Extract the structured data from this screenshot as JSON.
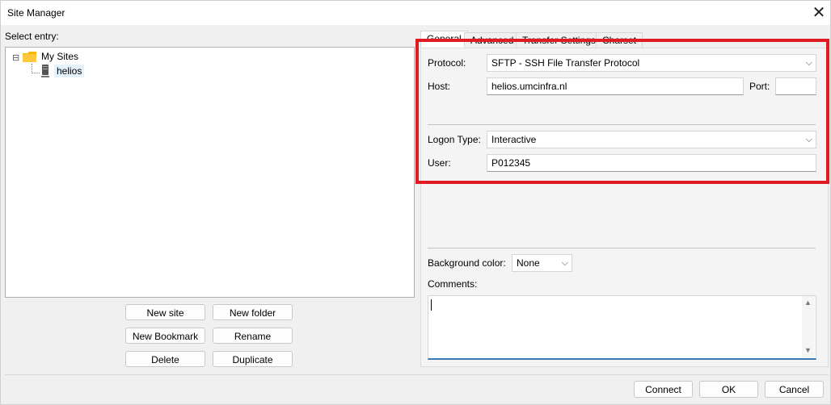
{
  "window": {
    "title": "Site Manager",
    "close_glyph": "✕"
  },
  "left": {
    "select_entry_label": "Select entry:",
    "tree": {
      "root": {
        "label": "My Sites",
        "expander": "⊟"
      },
      "child": {
        "label": "helios"
      }
    },
    "buttons": {
      "new_site": "New site",
      "new_folder": "New folder",
      "new_bookmark": "New Bookmark",
      "rename": "Rename",
      "delete": "Delete",
      "duplicate": "Duplicate"
    }
  },
  "tabs": [
    {
      "label": "General"
    },
    {
      "label": "Advanced"
    },
    {
      "label": "Transfer Settings"
    },
    {
      "label": "Charset"
    }
  ],
  "general": {
    "protocol_label": "Protocol:",
    "protocol_value": "SFTP - SSH File Transfer Protocol",
    "host_label": "Host:",
    "host_value": "helios.umcinfra.nl",
    "port_label": "Port:",
    "port_value": "",
    "logon_type_label": "Logon Type:",
    "logon_type_value": "Interactive",
    "user_label": "User:",
    "user_value": "P012345",
    "background_color_label": "Background color:",
    "background_color_value": "None",
    "comments_label": "Comments:",
    "comments_value": ""
  },
  "footer": {
    "connect": "Connect",
    "ok": "OK",
    "cancel": "Cancel"
  },
  "colors": {
    "highlight": "#e01b24",
    "folder": "#f5b700"
  }
}
